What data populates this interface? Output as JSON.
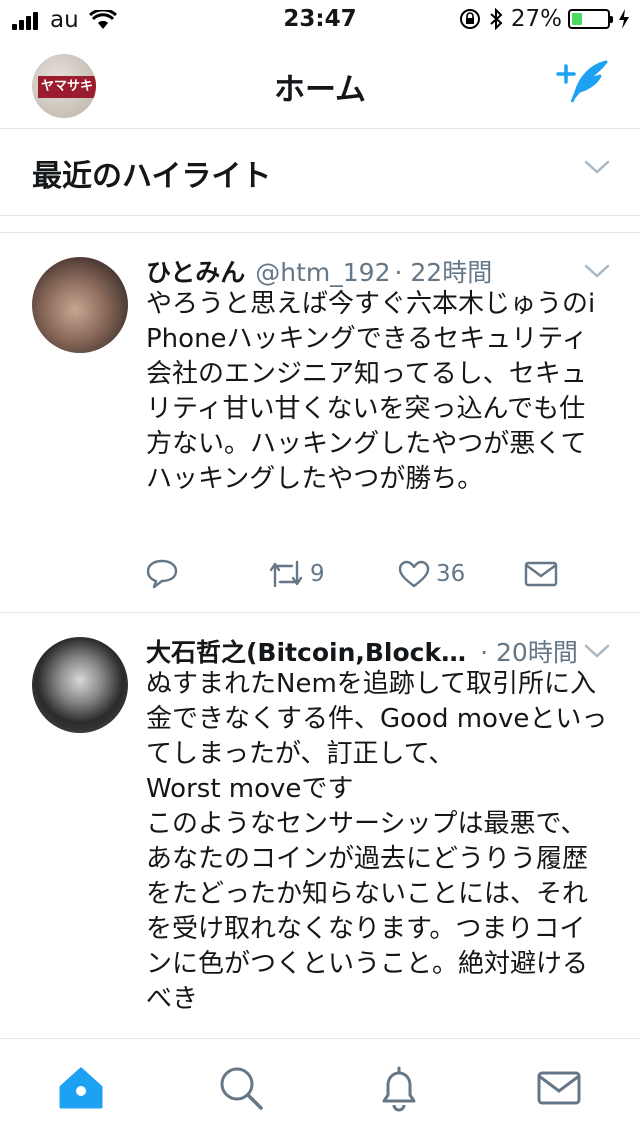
{
  "status_bar": {
    "carrier": "au",
    "time": "23:47",
    "battery": "27%",
    "battery_level": 0.27
  },
  "nav": {
    "title": "ホーム",
    "avatar_sign": "ヤマサキ"
  },
  "highlights": {
    "title": "最近のハイライト"
  },
  "tweets": [
    {
      "name": "ひとみん",
      "handle": "@htm_192",
      "time": "· 22時間",
      "text": "やろうと思えば今すぐ六本木じゅうのiPhoneハッキングできるセキュリティ会社のエンジニア知ってるし、セキュリティ甘い甘くないを突っ込んでも仕方ない。ハッキングしたやつが悪くてハッキングしたやつが勝ち。",
      "retweets": "9",
      "likes": "36"
    },
    {
      "name": "大石哲之(Bitcoin,Block…",
      "handle": "",
      "time": "· 20時間",
      "text": "ぬすまれたNemを追跡して取引所に入金できなくする件、Good moveといってしまったが、訂正して、\nWorst moveです\nこのようなセンサーシップは最悪で、あなたのコインが過去にどうりう履歴をたどったか知らないことには、それを受け取れなくなります。つまりコインに色がつくということ。絶対避けるべき"
    }
  ],
  "colors": {
    "accent": "#1da1f2",
    "secondary_text": "#657786",
    "divider": "#e1e8ed"
  }
}
